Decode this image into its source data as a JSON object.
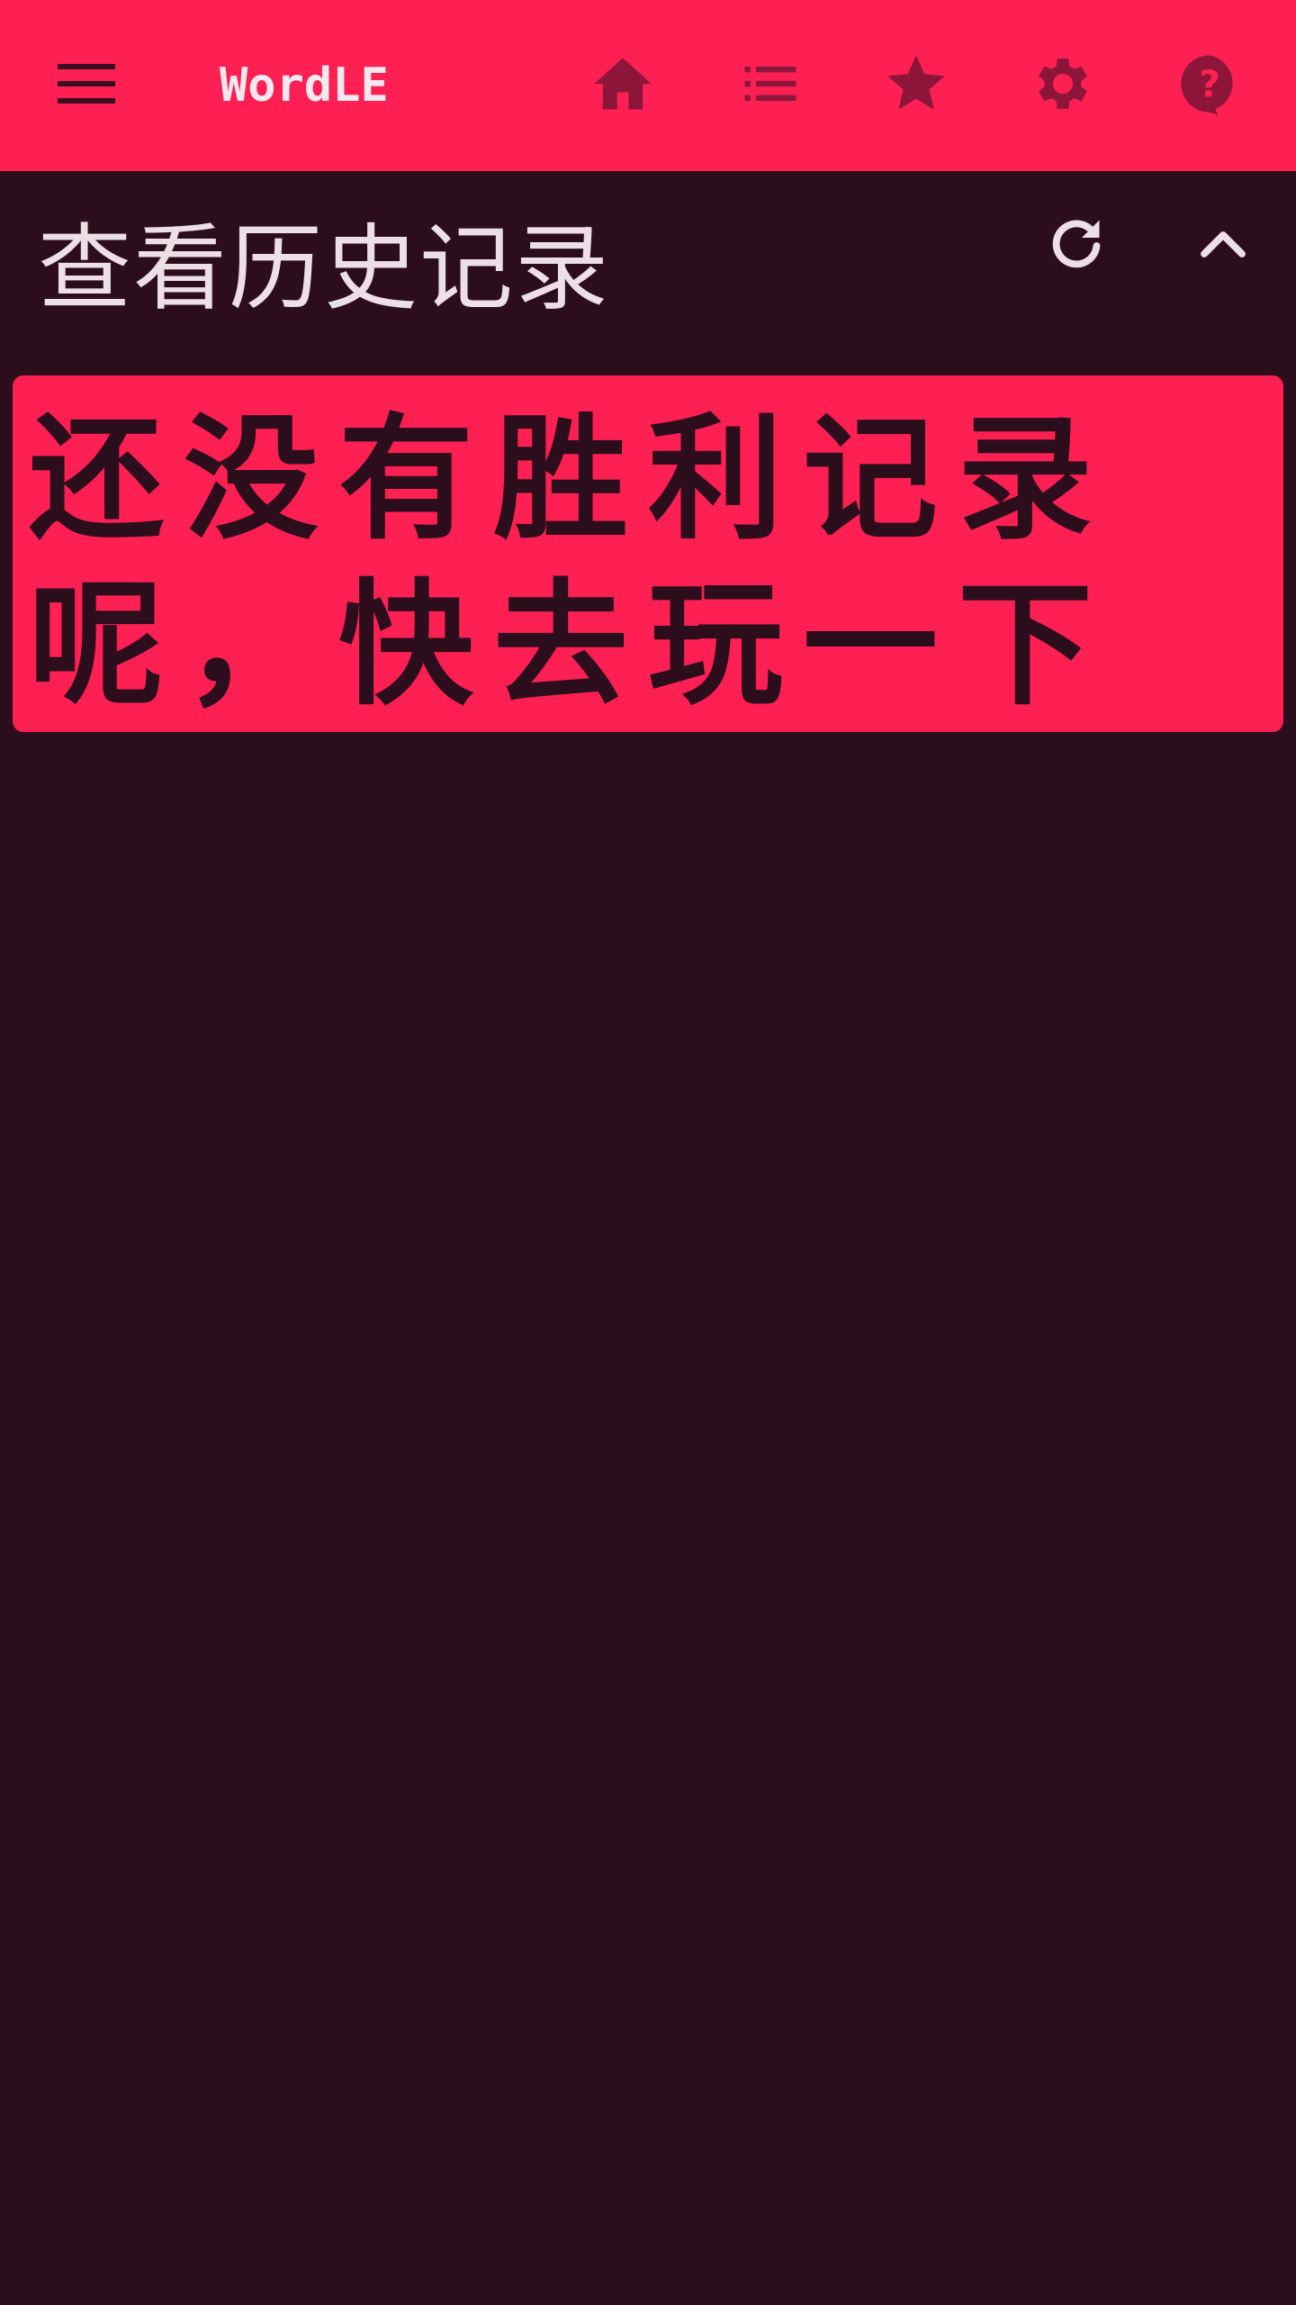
{
  "app_bar": {
    "title": "WordLE",
    "menu_icon": "hamburger-menu-icon",
    "nav_icons": [
      "home-icon",
      "list-icon",
      "star-icon",
      "gear-icon",
      "help-icon"
    ]
  },
  "history": {
    "title": "查看历史记录",
    "refresh_icon": "refresh-icon",
    "collapse_icon": "chevron-up-icon",
    "empty_message": "还没有胜利记录呢，快去玩一下吧！"
  },
  "colors": {
    "accent": "#fe1f53",
    "background": "#2c0d1c",
    "icon_dark": "#8c1539",
    "text_light": "#ecdfe6"
  }
}
